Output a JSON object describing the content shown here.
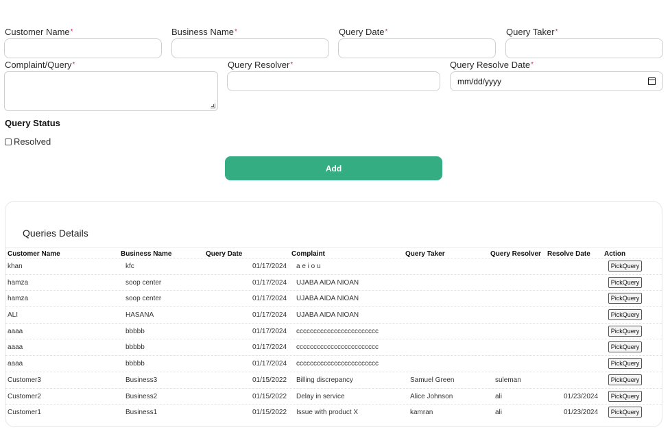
{
  "form": {
    "customer_name_label": "Customer Name",
    "business_name_label": "Business Name",
    "query_date_label": "Query Date",
    "query_taker_label": "Query Taker",
    "complaint_label": "Complaint/Query",
    "query_resolver_label": "Query Resolver",
    "resolve_date_label": "Query Resolve Date",
    "required_mark": "*",
    "resolve_date_placeholder": "mm/dd/yyyy",
    "status_title": "Query Status",
    "resolved_label": "Resolved",
    "add_button": "Add"
  },
  "table": {
    "title": "Queries Details",
    "headers": {
      "customer": "Customer Name",
      "business": "Business Name",
      "query_date": "Query Date",
      "complaint": "Complaint",
      "taker": "Query Taker",
      "resolver": "Query Resolver",
      "resolve_date": "Resolve Date",
      "action": "Action"
    },
    "action_label": "PickQuery",
    "rows": [
      {
        "customer": "khan",
        "business": "kfc",
        "query_date": "01/17/2024",
        "complaint": "a e i o u",
        "taker": "",
        "resolver": "",
        "resolve_date": ""
      },
      {
        "customer": "hamza",
        "business": "soop center",
        "query_date": "01/17/2024",
        "complaint": "UJABA AIDA NIOAN",
        "taker": "",
        "resolver": "",
        "resolve_date": ""
      },
      {
        "customer": "hamza",
        "business": "soop center",
        "query_date": "01/17/2024",
        "complaint": "UJABA AIDA NIOAN",
        "taker": "",
        "resolver": "",
        "resolve_date": ""
      },
      {
        "customer": "ALI",
        "business": "HASANA",
        "query_date": "01/17/2024",
        "complaint": "UJABA AIDA NIOAN",
        "taker": "",
        "resolver": "",
        "resolve_date": ""
      },
      {
        "customer": "aaaa",
        "business": "bbbbb",
        "query_date": "01/17/2024",
        "complaint": "cccccccccccccccccccccccc",
        "taker": "",
        "resolver": "",
        "resolve_date": ""
      },
      {
        "customer": "aaaa",
        "business": "bbbbb",
        "query_date": "01/17/2024",
        "complaint": "cccccccccccccccccccccccc",
        "taker": "",
        "resolver": "",
        "resolve_date": ""
      },
      {
        "customer": "aaaa",
        "business": "bbbbb",
        "query_date": "01/17/2024",
        "complaint": "cccccccccccccccccccccccc",
        "taker": "",
        "resolver": "",
        "resolve_date": ""
      },
      {
        "customer": "Customer3",
        "business": "Business3",
        "query_date": "01/15/2022",
        "complaint": "Billing discrepancy",
        "taker": "Samuel Green",
        "resolver": "suleman",
        "resolve_date": ""
      },
      {
        "customer": "Customer2",
        "business": "Business2",
        "query_date": "01/15/2022",
        "complaint": "Delay in service",
        "taker": "Alice Johnson",
        "resolver": "ali",
        "resolve_date": "01/23/2024"
      },
      {
        "customer": "Customer1",
        "business": "Business1",
        "query_date": "01/15/2022",
        "complaint": "Issue with product X",
        "taker": "kamran",
        "resolver": "ali",
        "resolve_date": "01/23/2024"
      }
    ]
  }
}
